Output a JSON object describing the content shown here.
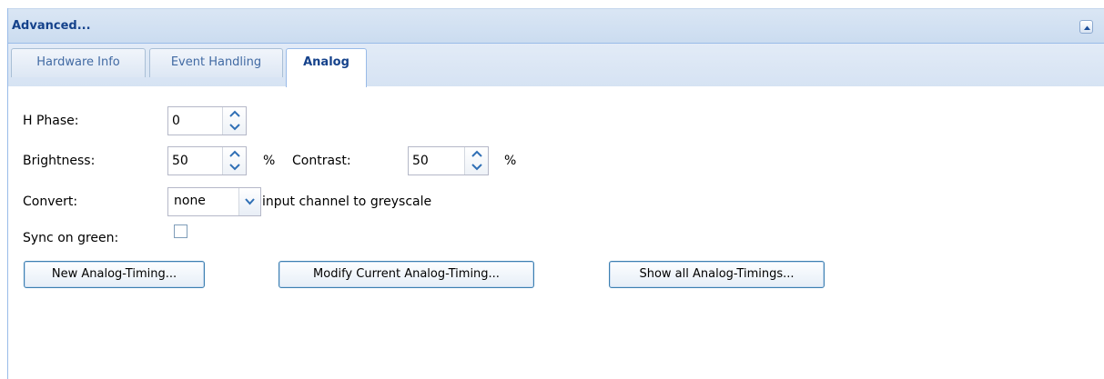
{
  "panel": {
    "title": "Advanced...",
    "collapse_icon": "chevron-up-icon"
  },
  "tabs": [
    {
      "label": "Hardware Info",
      "active": false
    },
    {
      "label": "Event Handling",
      "active": false
    },
    {
      "label": "Analog",
      "active": true
    }
  ],
  "form": {
    "h_phase": {
      "label": "H Phase:",
      "value": "0"
    },
    "brightness": {
      "label": "Brightness:",
      "value": "50",
      "unit": "%"
    },
    "contrast": {
      "label": "Contrast:",
      "value": "50",
      "unit": "%"
    },
    "convert": {
      "label": "Convert:",
      "value": "none",
      "suffix": "input channel to greyscale"
    },
    "sync_on_green": {
      "label": "Sync on green:",
      "checked": false
    }
  },
  "buttons": {
    "new_timing": "New Analog-Timing...",
    "modify_timing": "Modify Current Analog-Timing...",
    "show_all_timings": "Show all Analog-Timings..."
  },
  "colors": {
    "header_text": "#15428b",
    "border": "#99bbe8",
    "button_border": "#3c7fb1"
  }
}
